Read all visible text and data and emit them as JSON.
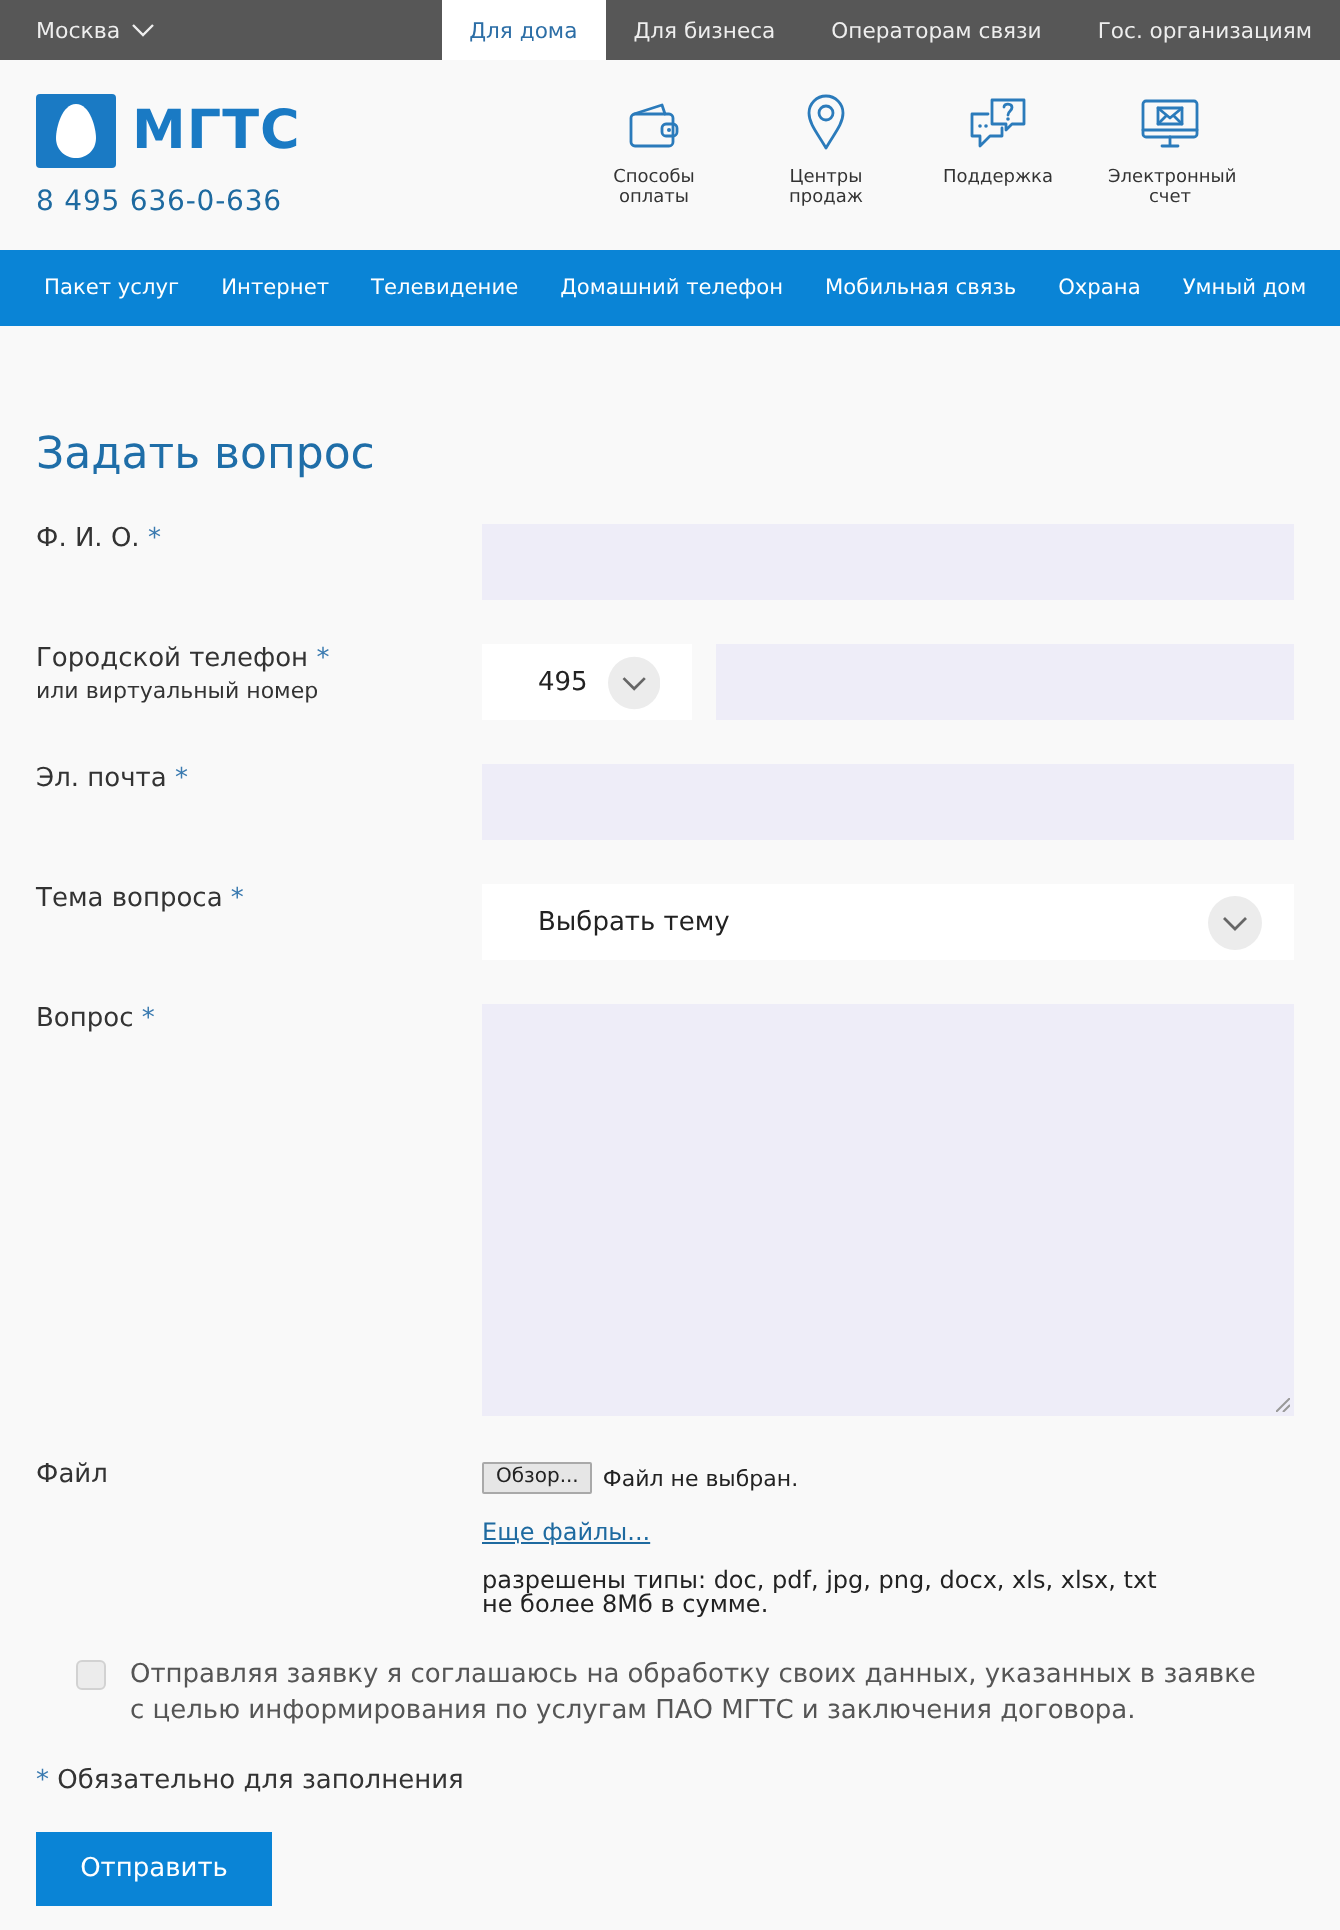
{
  "top_bar": {
    "region": "Москва",
    "segments": [
      {
        "label": "Для дома",
        "selected": true
      },
      {
        "label": "Для бизнеса",
        "selected": false
      },
      {
        "label": "Операторам связи",
        "selected": false
      },
      {
        "label": "Гос. организациям",
        "selected": false
      }
    ]
  },
  "header": {
    "logo": "МГТС",
    "phone": "8 495 636-0-636",
    "links": [
      {
        "kind": "wallet",
        "label": "Способы оплаты"
      },
      {
        "kind": "pin",
        "label": "Центры продаж"
      },
      {
        "kind": "chat",
        "label": "Поддержка"
      },
      {
        "kind": "monitor",
        "label": "Электронный счет"
      }
    ]
  },
  "nav": {
    "items": [
      "Пакет услуг",
      "Интернет",
      "Телевидение",
      "Домашний телефон",
      "Мобильная связь",
      "Охрана",
      "Умный дом"
    ]
  },
  "form": {
    "title": "Задать вопрос",
    "fields": [
      {
        "kind": "text",
        "label": "Ф. И. О.",
        "mark": "*"
      },
      {
        "kind": "phone",
        "label": "Городской телефон",
        "mark": "*",
        "hint": "или виртуальный номер",
        "code": "495"
      },
      {
        "kind": "text",
        "label": "Эл. почта",
        "mark": "*"
      },
      {
        "kind": "select",
        "label": "Тема вопроса",
        "mark": "*",
        "value": "Выбрать тему"
      },
      {
        "kind": "textarea",
        "label": "Вопрос",
        "mark": "*"
      },
      {
        "kind": "file",
        "label": "Файл",
        "button": "Обзор...",
        "status": "Файл не выбран.",
        "more": "Еще файлы...",
        "notes": [
          "разрешены типы: doc, pdf, jpg, png, docx, xls, xlsx, txt",
          "не более 8Мб в сумме."
        ]
      }
    ],
    "consent": {
      "checked": false,
      "text": "Отправляя заявку я соглашаюсь на обработку своих данных, указанных в заявке с целью информирования по услугам ПАО МГТС и заключения договора."
    },
    "required_note": {
      "mark": "*",
      "text": "Обязательно для заполнения"
    },
    "submit": "Отправить"
  }
}
